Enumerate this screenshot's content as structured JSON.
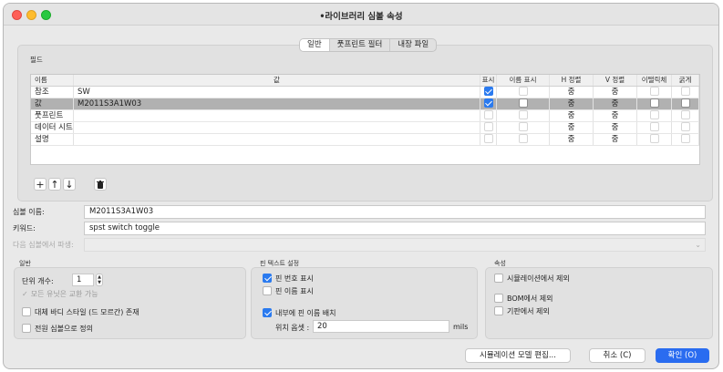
{
  "window": {
    "title": "•라이브러리 심볼 속성"
  },
  "tabs": [
    {
      "label": "일반",
      "active": true
    },
    {
      "label": "풋프린트 필터",
      "active": false
    },
    {
      "label": "내장 파일",
      "active": false
    }
  ],
  "fields": {
    "section_label": "필드",
    "headers": [
      "이름",
      "값",
      "표시",
      "이름 표시",
      "H 정렬",
      "V 정렬",
      "이탤릭체",
      "굵게"
    ],
    "rows": [
      {
        "name": "참조",
        "value": "SW",
        "show": true,
        "show_name": false,
        "h_align": "중",
        "v_align": "중",
        "italic": false,
        "bold": false,
        "selected": false
      },
      {
        "name": "값",
        "value": "M2011S3A1W03",
        "show": true,
        "show_name": false,
        "h_align": "중",
        "v_align": "중",
        "italic": false,
        "bold": false,
        "selected": true
      },
      {
        "name": "풋프린트",
        "value": "",
        "show": false,
        "show_name": false,
        "h_align": "중",
        "v_align": "중",
        "italic": false,
        "bold": false,
        "selected": false
      },
      {
        "name": "데이터 시트",
        "value": "",
        "show": false,
        "show_name": false,
        "h_align": "중",
        "v_align": "중",
        "italic": false,
        "bold": false,
        "selected": false
      },
      {
        "name": "설명",
        "value": "",
        "show": false,
        "show_name": false,
        "h_align": "중",
        "v_align": "중",
        "italic": false,
        "bold": false,
        "selected": false
      }
    ],
    "toolbar": {
      "add_icon": "plus-icon",
      "up_icon": "arrow-up-icon",
      "down_icon": "arrow-down-icon",
      "delete_icon": "trash-icon"
    }
  },
  "symbol_name": {
    "label": "심볼 이름:",
    "value": "M2011S3A1W03"
  },
  "keywords": {
    "label": "키워드:",
    "value": "spst switch toggle"
  },
  "derive_from": {
    "label": "다음 심볼에서 파생:",
    "value": ""
  },
  "general": {
    "label": "일반",
    "unit_count_label": "단위 개수:",
    "unit_count_value": "1",
    "all_units_interchangeable": "모든 유닛은 교환 가능",
    "alternate_body_style": "대체 바디 스타일 (드 모르간) 존재",
    "define_as_power_symbol": "전원 심볼으로 정의"
  },
  "pin_text": {
    "label": "핀 텍스트 설정",
    "show_pin_numbers": "핀 번호 표시",
    "show_pin_names": "핀 이름 표시",
    "place_names_inside": "내부에 핀 이름 배치",
    "offset_label": "위치 옵셋 :",
    "offset_value": "20",
    "offset_unit": "mils"
  },
  "attributes": {
    "label": "속성",
    "exclude_from_simulation": "시뮬레이션에서 제외",
    "exclude_from_bom": "BOM에서 제외",
    "exclude_from_board": "기판에서 제외"
  },
  "buttons": {
    "edit_sim_model": "시뮬레이션 모델 편집...",
    "cancel": "취소 (C)",
    "ok": "확인 (O)"
  },
  "colors": {
    "accent": "#2a6cf0",
    "selected_row": "#b1b1b1"
  }
}
